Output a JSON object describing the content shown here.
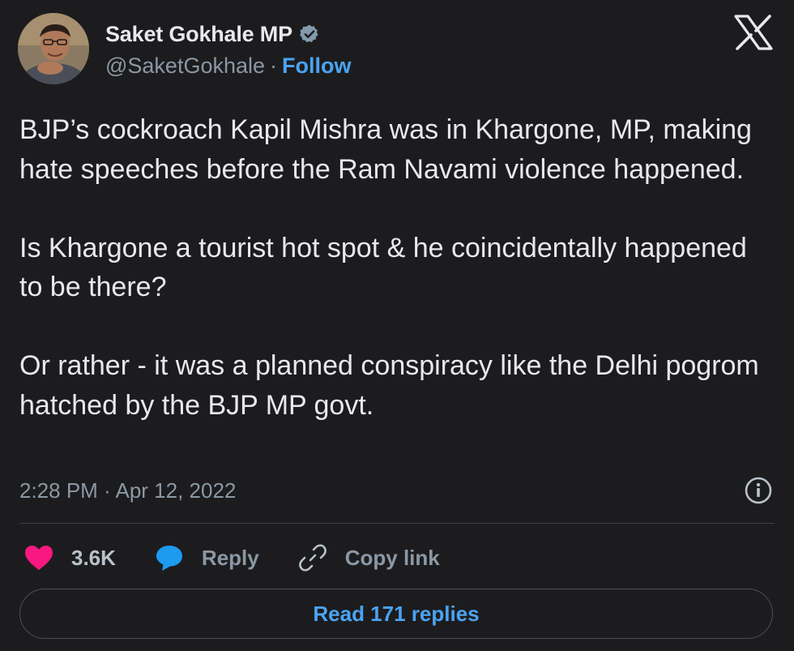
{
  "author": {
    "display_name": "Saket Gokhale MP",
    "handle": "@SaketGokhale",
    "separator": "·",
    "follow_label": "Follow",
    "verified_color": "#829aab"
  },
  "brand": {
    "logo": "x-logo-icon"
  },
  "tweet": {
    "text": "BJP’s cockroach Kapil Mishra was in Khargone, MP, making hate speeches before the Ram Navami violence happened.\n\nIs Khargone a tourist hot spot & he coincidentally happened to be there?\n\nOr rather - it was a planned conspiracy like the Delhi pogrom hatched by the BJP MP govt.",
    "timestamp": "2:28 PM · Apr 12, 2022"
  },
  "actions": {
    "like_count": "3.6K",
    "like_color": "#f91880",
    "reply_label": "Reply",
    "reply_color": "#1d9bf0",
    "copy_link_label": "Copy link"
  },
  "footer": {
    "read_replies_label": "Read 171 replies",
    "accent_color": "#4ba3f2"
  }
}
